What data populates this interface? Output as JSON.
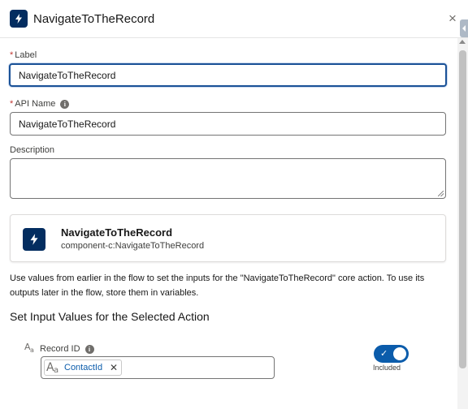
{
  "header": {
    "title": "NavigateToTheRecord",
    "icon": "lightning-bolt-icon",
    "close_glyph": "×"
  },
  "form": {
    "label": {
      "required_mark": "*",
      "text": "Label",
      "value": "NavigateToTheRecord"
    },
    "api_name": {
      "required_mark": "*",
      "text": "API Name",
      "info_glyph": "i",
      "value": "NavigateToTheRecord"
    },
    "description": {
      "text": "Description",
      "value": ""
    }
  },
  "action_card": {
    "icon": "lightning-bolt-icon",
    "title": "NavigateToTheRecord",
    "subtitle": "component-c:NavigateToTheRecord"
  },
  "help_text": "Use values from earlier in the flow to set the inputs for the \"NavigateToTheRecord\" core action. To use its outputs later in the flow, store them in variables.",
  "section_title": "Set Input Values for the Selected Action",
  "input_param": {
    "type_glyph_big": "A",
    "type_glyph_small": "a",
    "label": "Record ID",
    "info_glyph": "i",
    "pill_label": "ContactId",
    "pill_remove_glyph": "✕",
    "toggle_label": "Included",
    "toggle_on": true,
    "toggle_check": "✓"
  },
  "colors": {
    "brand_navy": "#032d60",
    "accent_blue": "#0b5cab",
    "focus_border": "#1b5297",
    "required_red": "#c23934"
  }
}
